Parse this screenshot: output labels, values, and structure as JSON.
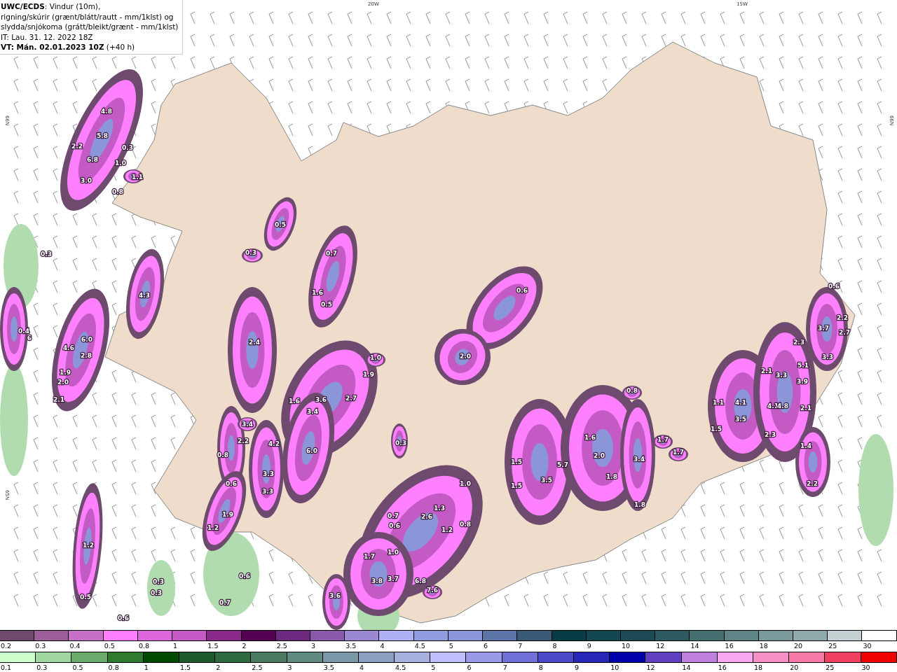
{
  "info_box": {
    "lines": [
      "**UWC/ECDS**: Vindur (10m),",
      "rigning/skúrir (grænt/blátt/rautt - mm/1klst) og",
      "slydda/snjókoma (grátt/bleikt/grænt - mm/1klst)",
      "IT: Lau. 31. 12. 2022 18Z",
      "**VT: Mán. 02.01.2023 10Z** (+40 h)"
    ]
  },
  "map": {
    "grid_labels": [
      "20W",
      "15W",
      "66N",
      "66N",
      "65N"
    ],
    "values": [
      "4.8",
      "5.8",
      "2.2",
      "0.3",
      "6.8",
      "1.0",
      "3.0",
      "1.1",
      "0.8",
      "0.5",
      "0.3",
      "0.3",
      "0.7",
      "4.3",
      "1.6",
      "0.5",
      "0.6",
      "0.4",
      "6",
      "6.0",
      "4.6",
      "2.8",
      "1.9",
      "2.0",
      "2.1",
      "2.4",
      "1.0",
      "2.0",
      "1.9",
      "1.6",
      "3.6",
      "2.7",
      "3.4",
      "3.4",
      "4.2",
      "6.0",
      "0.3",
      "2.2",
      "3.3",
      "3.3",
      "0.8",
      "0.6",
      "1.9",
      "1.2",
      "1.2",
      "0.5",
      "0.3",
      "0.3",
      "0.6",
      "0.7",
      "0.6",
      "1.0",
      "0.7",
      "0.6",
      "2.6",
      "1.3",
      "1.2",
      "0.8",
      "1.7",
      "1.0",
      "3.8",
      "3.7",
      "6.8",
      "7.6",
      "3.6",
      "1.5",
      "1.5",
      "3.5",
      "5.7",
      "1.6",
      "2.0",
      "1.8",
      "3.4",
      "1.8",
      "0.8",
      "1.7",
      "1.7",
      "1.1",
      "4.1",
      "3.5",
      "1.5",
      "2.3",
      "2.1",
      "3.3",
      "4.1",
      "4.8",
      "3.9",
      "5.1",
      "2.3",
      "3.7",
      "3.3",
      "2.7",
      "2.2",
      "0.6",
      "2.1",
      "1.4",
      "2.2"
    ]
  },
  "snow_scale": [
    {
      "label": "0.2",
      "color": "#6e4a6e"
    },
    {
      "label": "0.3",
      "color": "#9c5f9c"
    },
    {
      "label": "0.4",
      "color": "#c770c7"
    },
    {
      "label": "0.5",
      "color": "#ff80ff"
    },
    {
      "label": "0.8",
      "color": "#dd66dd"
    },
    {
      "label": "1",
      "color": "#c45bc4"
    },
    {
      "label": "1.5",
      "color": "#8a2a8a"
    },
    {
      "label": "2",
      "color": "#520052"
    },
    {
      "label": "2.5",
      "color": "#6b2a7e"
    },
    {
      "label": "3",
      "color": "#8a5aaa"
    },
    {
      "label": "3.5",
      "color": "#9a88d0"
    },
    {
      "label": "4",
      "color": "#b0b0f5"
    },
    {
      "label": "4.5",
      "color": "#8f9ce0"
    },
    {
      "label": "5",
      "color": "#8a96d8"
    },
    {
      "label": "6",
      "color": "#5c74a8"
    },
    {
      "label": "7",
      "color": "#3a5a78"
    },
    {
      "label": "8",
      "color": "#0a3c46"
    },
    {
      "label": "9",
      "color": "#134650"
    },
    {
      "label": "10",
      "color": "#1e4a55"
    },
    {
      "label": "12",
      "color": "#2d5a60"
    },
    {
      "label": "14",
      "color": "#456e70"
    },
    {
      "label": "16",
      "color": "#5e8488"
    },
    {
      "label": "18",
      "color": "#7a9a9c"
    },
    {
      "label": "20",
      "color": "#8faaaa"
    },
    {
      "label": "25",
      "color": "#c4d0d2"
    },
    {
      "label": "30",
      "color": "#ffffff"
    }
  ],
  "rain_scale": [
    {
      "label": "0.1",
      "color": "#ccffcc"
    },
    {
      "label": "0.3",
      "color": "#9ed69e"
    },
    {
      "label": "0.5",
      "color": "#6aaa6a"
    },
    {
      "label": "0.8",
      "color": "#2e7a2e"
    },
    {
      "label": "1",
      "color": "#004a00"
    },
    {
      "label": "1.5",
      "color": "#1e5a2a"
    },
    {
      "label": "2",
      "color": "#2e6a40"
    },
    {
      "label": "2.5",
      "color": "#4a7a60"
    },
    {
      "label": "3",
      "color": "#5e8a80"
    },
    {
      "label": "3.5",
      "color": "#7a98a8"
    },
    {
      "label": "4",
      "color": "#8aa0c0"
    },
    {
      "label": "4.5",
      "color": "#a8b0e0"
    },
    {
      "label": "5",
      "color": "#c0c0ff"
    },
    {
      "label": "6",
      "color": "#9a9ae8"
    },
    {
      "label": "7",
      "color": "#7070d8"
    },
    {
      "label": "8",
      "color": "#4a4ac8"
    },
    {
      "label": "9",
      "color": "#2828b8"
    },
    {
      "label": "10",
      "color": "#0000aa"
    },
    {
      "label": "12",
      "color": "#6040c0"
    },
    {
      "label": "14",
      "color": "#c080e0"
    },
    {
      "label": "16",
      "color": "#f8a8f0"
    },
    {
      "label": "18",
      "color": "#f890c8"
    },
    {
      "label": "20",
      "color": "#f87aa8"
    },
    {
      "label": "25",
      "color": "#f04060"
    },
    {
      "label": "30",
      "color": "#f00000"
    }
  ]
}
